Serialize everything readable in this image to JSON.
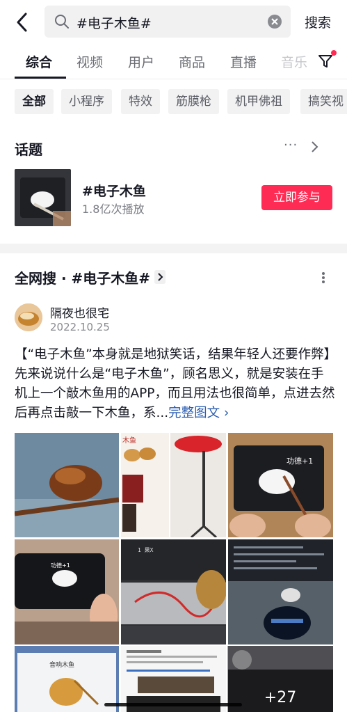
{
  "search": {
    "query": "#电子木鱼#",
    "search_button": "搜索"
  },
  "tabs": [
    "综合",
    "视频",
    "用户",
    "商品",
    "直播",
    "音乐"
  ],
  "active_tab_index": 0,
  "chips": [
    "全部",
    "小程序",
    "特效",
    "筋膜枪",
    "机甲佛祖",
    "搞笑视"
  ],
  "topic": {
    "section_title": "话题",
    "name": "#电子木鱼",
    "plays": "1.8亿次播放",
    "join_button": "立即参与"
  },
  "article": {
    "section_title": "全网搜 · #电子木鱼#",
    "author": "隔夜也很宅",
    "date": "2022.10.25",
    "body": "【“电子木鱼”本身就是地狱笑话，结果年轻人还要作弊】先来说说什么是“电子木鱼”，顾名思义，就是安装在手机上一个敲木鱼用的APP，而且用法也很简单，点进去然后再点击敲一下木鱼，系...",
    "more_link": "完整图文",
    "grid_overlay": "+27",
    "image_texts": {
      "merit": "功德+1",
      "merit_small": "功德+1",
      "wood_fish_label": "木鱼",
      "electronic_wood_fish": "音响木鱼",
      "merit_count": "1 果X"
    }
  },
  "colors": {
    "accent": "#fe2c55",
    "link": "#2a5db0",
    "text": "#161823"
  }
}
